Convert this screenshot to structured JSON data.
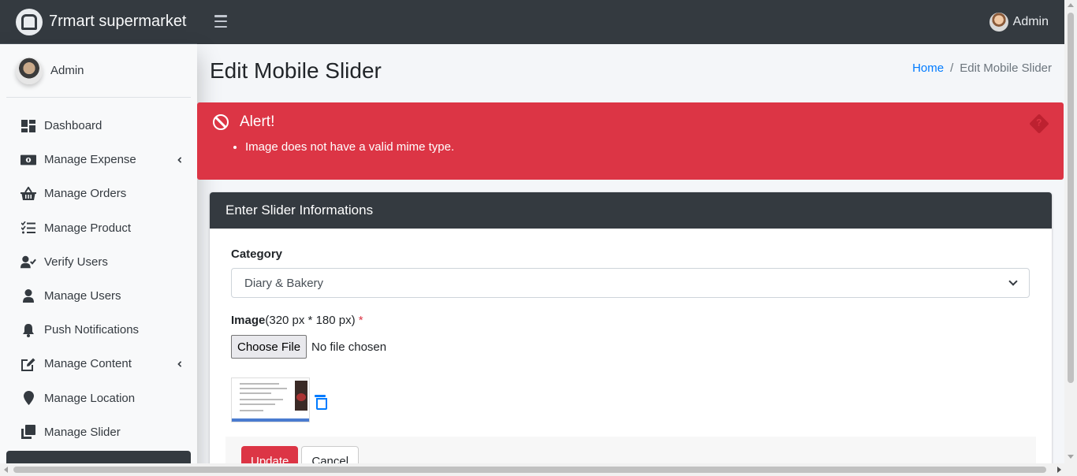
{
  "brand": {
    "name": "7rmart supermarket"
  },
  "topbar": {
    "user_name": "Admin"
  },
  "sidebar": {
    "user_name": "Admin",
    "items": [
      {
        "label": "Dashboard",
        "icon": "dashboard-icon"
      },
      {
        "label": "Manage Expense",
        "icon": "money-icon",
        "has_submenu": true
      },
      {
        "label": "Manage Orders",
        "icon": "basket-icon"
      },
      {
        "label": "Manage Product",
        "icon": "tasks-icon"
      },
      {
        "label": "Verify Users",
        "icon": "user-check-icon"
      },
      {
        "label": "Manage Users",
        "icon": "user-icon"
      },
      {
        "label": "Push Notifications",
        "icon": "bell-icon"
      },
      {
        "label": "Manage Content",
        "icon": "edit-icon",
        "has_submenu": true
      },
      {
        "label": "Manage Location",
        "icon": "map-marker-icon"
      },
      {
        "label": "Manage Slider",
        "icon": "clone-icon"
      }
    ]
  },
  "page": {
    "title": "Edit Mobile Slider",
    "breadcrumb": {
      "home": "Home",
      "separator": "/",
      "current": "Edit Mobile Slider"
    }
  },
  "alert": {
    "title": "Alert!",
    "messages": [
      "Image does not have a valid mime type."
    ],
    "color": "#dc3545"
  },
  "form": {
    "header": "Enter Slider Informations",
    "category_label": "Category",
    "category_value": "Diary & Bakery",
    "image_label": "Image",
    "image_hint": "(320 px * 180 px)",
    "required_mark": "*",
    "file_button": "Choose File",
    "file_status": "No file chosen",
    "update_button": "Update",
    "cancel_button": "Cancel"
  }
}
